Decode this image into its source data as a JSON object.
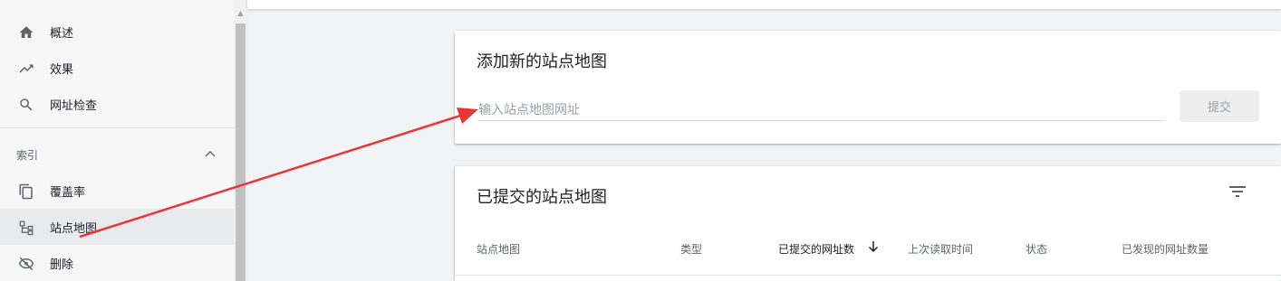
{
  "sidebar": {
    "items": [
      {
        "label": "概述",
        "icon": "home-icon"
      },
      {
        "label": "效果",
        "icon": "trending-up-icon"
      },
      {
        "label": "网址检查",
        "icon": "search-icon"
      }
    ],
    "section": {
      "label": "索引",
      "icon": "chevron-up-icon"
    },
    "index_items": [
      {
        "label": "覆盖率",
        "icon": "copy-pages-icon"
      },
      {
        "label": "站点地图",
        "icon": "sitemap-icon",
        "active": true
      },
      {
        "label": "删除",
        "icon": "eye-off-icon"
      }
    ]
  },
  "add_card": {
    "title": "添加新的站点地图",
    "input_placeholder": "输入站点地图网址",
    "input_value": "",
    "submit_label": "提交"
  },
  "submitted_card": {
    "title": "已提交的站点地图",
    "filter_icon": "filter-icon",
    "columns": [
      "站点地图",
      "类型",
      "已提交的网址数",
      "上次读取时间",
      "状态",
      "已发现的网址数量"
    ],
    "sorted_column": "已提交的网址数",
    "sort_direction": "descending"
  },
  "colors": {
    "annotation_arrow": "#e8373a",
    "active_nav_bg": "#e8eaed",
    "text_primary": "#202124",
    "text_secondary": "#5f6368"
  }
}
